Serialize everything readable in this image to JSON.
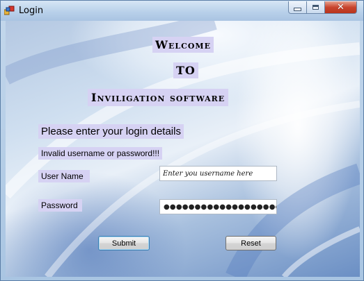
{
  "window": {
    "title": "Login",
    "controls": {
      "minimize": "minimize-icon",
      "maximize": "maximize-icon",
      "close": "close-icon"
    }
  },
  "banner": {
    "line1": "Welcome",
    "line2": "TO",
    "line3": "Inviligation software"
  },
  "form": {
    "prompt": "Please enter your login details",
    "error": "Invalid username or password!!!",
    "username_label": "User Name",
    "username_placeholder": "Enter you username here",
    "password_label": "Password",
    "password_mask": "●●●●●●●●●●●●●●●●●●●●●●",
    "submit_label": "Submit",
    "reset_label": "Reset"
  },
  "colors": {
    "label_bg": "#d6d2f3",
    "close_button": "#c8452e"
  }
}
